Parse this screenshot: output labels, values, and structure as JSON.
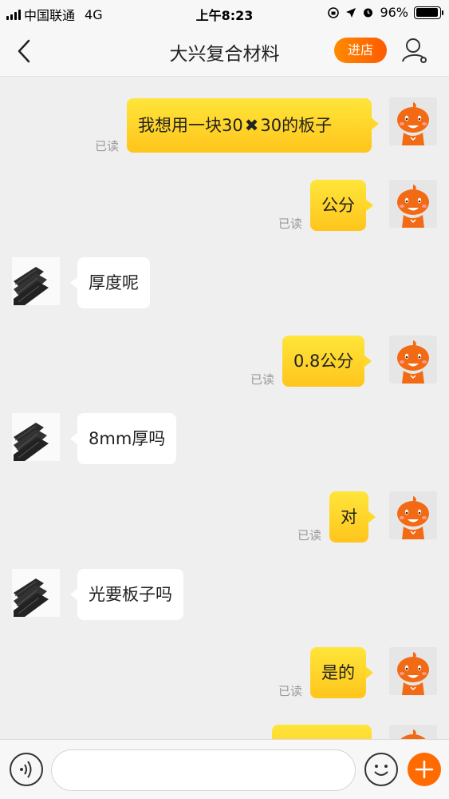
{
  "status_bar": {
    "carrier": "中国联通",
    "network": "4G",
    "time": "上午8:23",
    "battery": "96%",
    "battery_level": 0.96
  },
  "nav": {
    "title": "大兴复合材料",
    "store_button": "进店"
  },
  "messages": [
    {
      "sender": "me",
      "text_before": "我想用一块30",
      "symbol": "✖",
      "text_after": "30的板子",
      "status": "已读"
    },
    {
      "sender": "me",
      "text": "公分",
      "status": "已读"
    },
    {
      "sender": "them",
      "text": "厚度呢"
    },
    {
      "sender": "me",
      "text": "0.8公分",
      "status": "已读"
    },
    {
      "sender": "them",
      "text": "8mm厚吗"
    },
    {
      "sender": "me",
      "text": "对",
      "status": "已读"
    },
    {
      "sender": "them",
      "text": "光要板子吗"
    },
    {
      "sender": "me",
      "text": "是的",
      "status": "已读"
    }
  ],
  "input": {
    "value": "",
    "placeholder": ""
  },
  "icons": {
    "back": "chevron-left-icon",
    "profile": "user-settings-icon",
    "voice": "voice-icon",
    "emoji": "smiley-icon",
    "plus": "plus-icon"
  },
  "colors": {
    "accent": "#ff6b00",
    "bubble_me": "#ffd82a",
    "bubble_them": "#ffffff"
  }
}
